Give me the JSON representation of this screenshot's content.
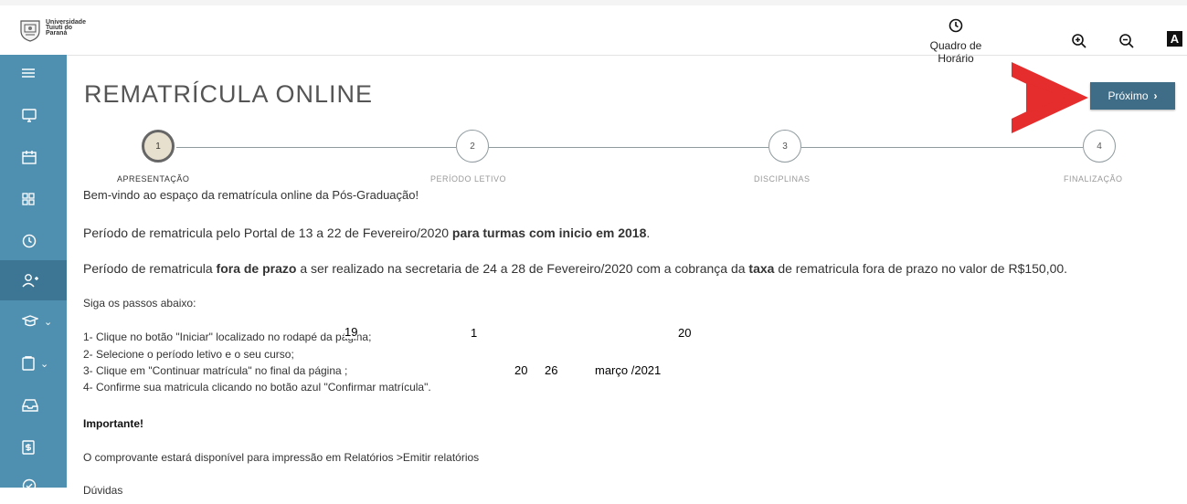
{
  "header": {
    "logo_text": [
      "Universidade",
      "Tuiuti do",
      "Paraná"
    ],
    "schedule_label": "Quadro de Horário",
    "icons": [
      "clock-icon",
      "zoom-in-icon",
      "zoom-out-icon",
      "contrast-icon"
    ],
    "contrast_glyph": "A"
  },
  "sidebar": {
    "items": [
      {
        "icon": "menu-icon",
        "glyph": "≡"
      },
      {
        "icon": "monitor-icon",
        "glyph": "▭"
      },
      {
        "icon": "calendar-icon",
        "glyph": "▤"
      },
      {
        "icon": "grid-icon",
        "glyph": "⊞"
      },
      {
        "icon": "clock-icon",
        "glyph": "◷"
      },
      {
        "icon": "user-add-icon",
        "glyph": "⚇"
      },
      {
        "icon": "graduation-icon",
        "glyph": "✎"
      },
      {
        "icon": "clipboard-icon",
        "glyph": "▢"
      },
      {
        "icon": "inbox-icon",
        "glyph": "⌂"
      },
      {
        "icon": "finance-icon",
        "glyph": "$"
      },
      {
        "icon": "check-icon",
        "glyph": "✓"
      }
    ]
  },
  "main": {
    "title": "REMATRÍCULA ONLINE",
    "next_label": "Próximo",
    "steps": [
      {
        "number": "1",
        "label": "APRESENTAÇÃO"
      },
      {
        "number": "2",
        "label": "PERÍODO LETIVO"
      },
      {
        "number": "3",
        "label": "DISCIPLINAS"
      },
      {
        "number": "4",
        "label": "FINALIZAÇÃO"
      }
    ],
    "welcome": "Bem-vindo ao espaço da rematrícula online da Pós-Graduação!",
    "period1": {
      "pre": "Período de rematricula pelo Portal de 13 a 22 de Fevereiro/2020 ",
      "bold": "para turmas com inicio em 2018",
      "post": "."
    },
    "period2": {
      "pre": "Período de rematricula ",
      "bold1": "fora de prazo",
      "mid": " a ser realizado na secretaria de 24 a 28 de Fevereiro/2020 com a cobrança da ",
      "bold2": "taxa",
      "post": " de rematricula fora de prazo no valor de R$150,00."
    },
    "steps_intro": "Siga os passos abaixo:",
    "list": [
      "1- Clique no botão  \"Iniciar\" localizado no rodapé da página;",
      "2- Selecione o período letivo e o seu curso;",
      "3- Clique em \"Continuar matrícula\" no final da página ;",
      "4- Confirme sua matricula clicando  no botão azul  \"Confirmar matrícula\"."
    ],
    "overlay_numbers": {
      "a": "19",
      "b": "1",
      "c": "20",
      "d": "20",
      "e": "26",
      "f": "março /2021"
    },
    "important": "Importante!",
    "receipt": "O comprovante estará disponível para impressão em Relatórios >Emitir relatórios",
    "cutoff": "Dúvidas"
  },
  "colors": {
    "sidebar": "#4f8fb0",
    "sidebar_active": "#3d7694",
    "next_button": "#3f6c86",
    "arrow": "#e52d2d"
  }
}
